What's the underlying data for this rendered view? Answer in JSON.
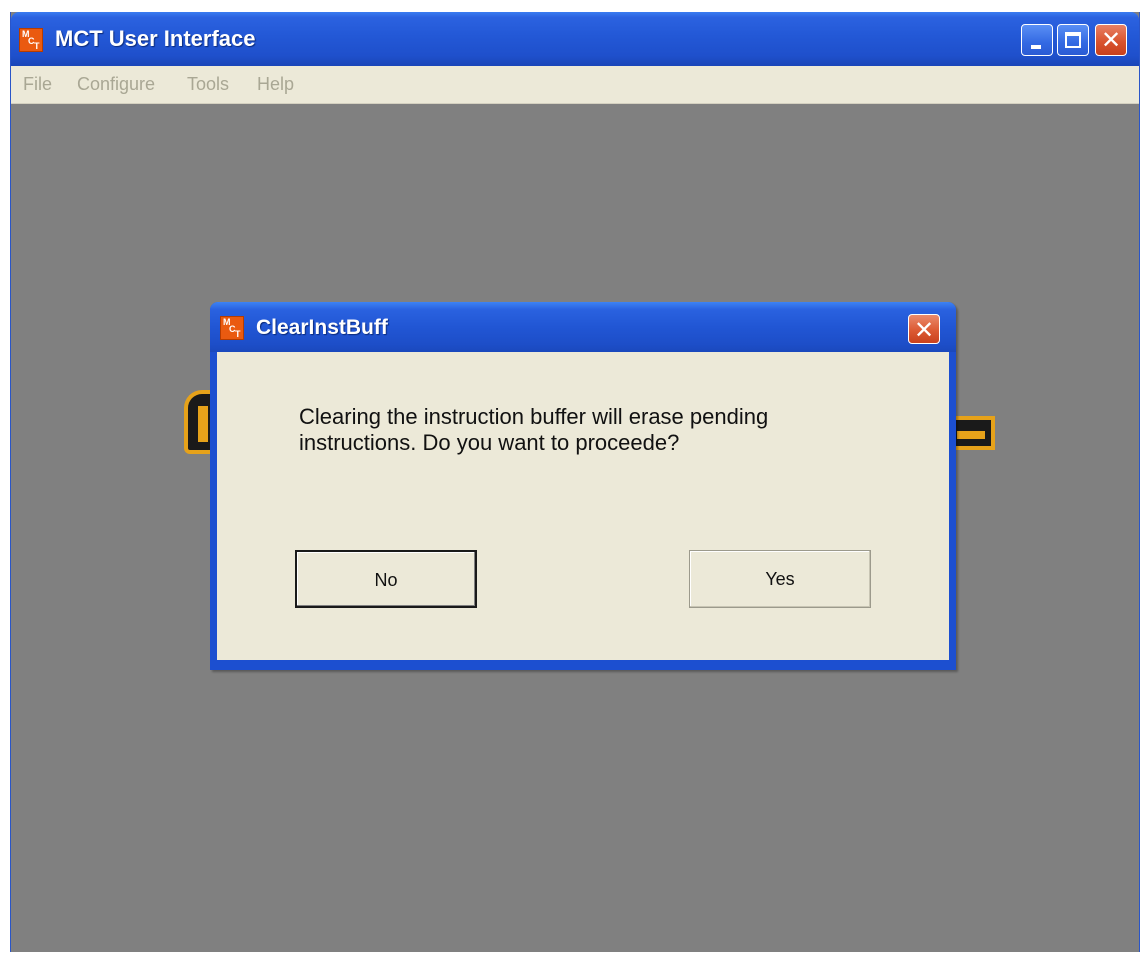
{
  "window": {
    "title": "MCT User Interface",
    "icon": "mct-app-icon",
    "icon_letters": [
      "M",
      "C",
      "T"
    ],
    "controls": {
      "minimize": "minimize-icon",
      "maximize": "maximize-icon",
      "close": "close-icon",
      "close_glyph": "✕"
    }
  },
  "menubar": {
    "items": [
      {
        "label": "File"
      },
      {
        "label": "Configure"
      },
      {
        "label": "Tools"
      },
      {
        "label": "Help"
      }
    ]
  },
  "dialog": {
    "title": "ClearInstBuff",
    "icon": "mct-app-icon",
    "close_glyph": "✕",
    "message_line1": "Clearing the instruction buffer will erase pending",
    "message_line2": "instructions.  Do you want to proceede?",
    "buttons": {
      "no_label": "No",
      "yes_label": "Yes"
    }
  },
  "colors": {
    "titlebar_blue": "#2358d6",
    "close_red": "#d9542f",
    "window_bg_gray": "#808080",
    "dialog_body": "#ece9d8",
    "logo_orange": "#e6a21a",
    "app_icon_orange": "#ea5a10"
  }
}
